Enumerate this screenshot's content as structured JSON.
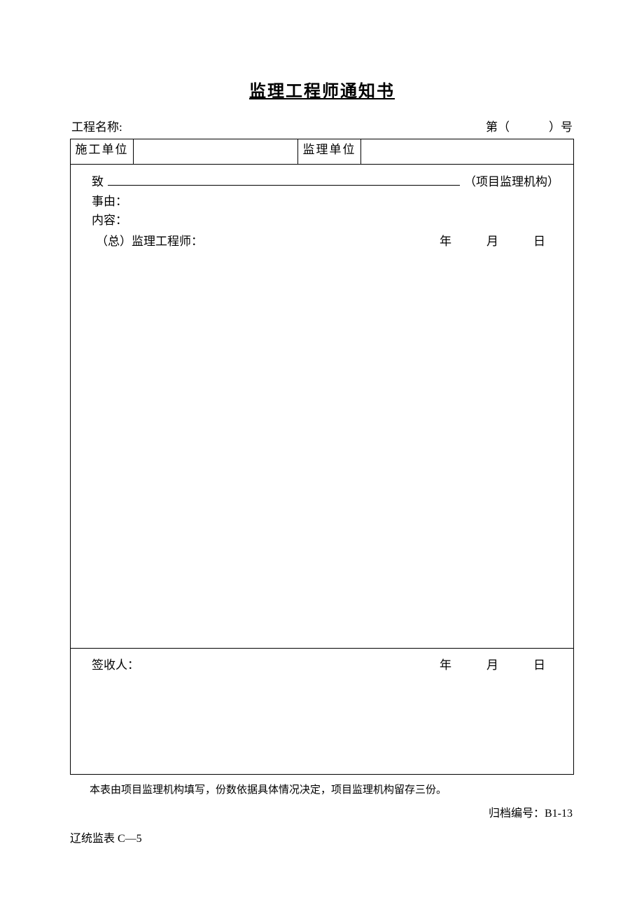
{
  "title": "监理工程师通知书",
  "header": {
    "project_name_label": "工程名称:",
    "project_name_value": "",
    "number_prefix": "第（",
    "number_value": "",
    "number_suffix": "）号"
  },
  "units_row": {
    "construction_unit_label": "施工单位",
    "construction_unit_value": "",
    "supervision_unit_label": "监理单位",
    "supervision_unit_value": ""
  },
  "body": {
    "to_label": "致",
    "to_value": "",
    "to_suffix": "（项目监理机构）",
    "reason_label": "事由：",
    "reason_value": "",
    "content_label": "内容：",
    "content_value": "",
    "engineer_label": "（总）监理工程师：",
    "engineer_value": "",
    "date_year_label": "年",
    "date_month_label": "月",
    "date_day_label": "日"
  },
  "signoff": {
    "signer_label": "签收人：",
    "signer_value": "",
    "date_year_label": "年",
    "date_month_label": "月",
    "date_day_label": "日"
  },
  "footer": {
    "note": "本表由项目监理机构填写，份数依据具体情况决定，项目监理机构留存三份。",
    "archive_label": "归档编号：",
    "archive_value": "B1-13",
    "form_code": "辽统监表 C—5"
  }
}
